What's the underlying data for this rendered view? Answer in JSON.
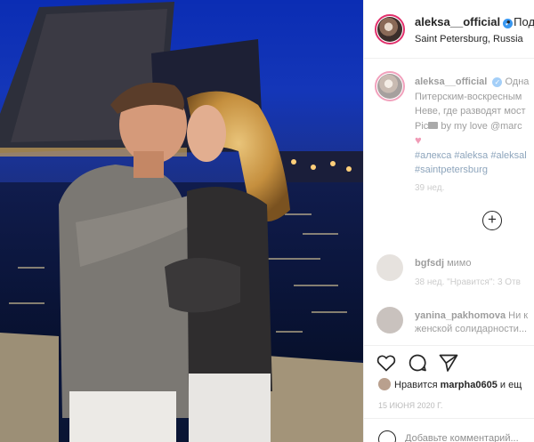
{
  "photo": {
    "description_icon": "photo-icon"
  },
  "header": {
    "username": "aleksa__official",
    "verified_icon": "verified-badge-icon",
    "follow_label": "• Под",
    "location": "Saint Petersburg, Russia"
  },
  "caption": {
    "username": "aleksa__official",
    "line1": "Одна",
    "line2": "Питерским-воскресным",
    "line3": "Неве, где разводят мост",
    "line4_prefix": "Pic",
    "line4_suffix": " by my love @marc",
    "heart": "♥",
    "hashtags_line1": "#алекса #aleksa #aleksal",
    "hashtags_line2": "#saintpetersburg",
    "time": "39 нед."
  },
  "load_more_icon": "plus-circle-icon",
  "comments": [
    {
      "user": "bgfsdj",
      "text": "мимо",
      "meta": "38 нед.    \"Нравится\": 3    Отв"
    },
    {
      "user": "yanina_pakhomova",
      "text": "Ни к",
      "line2": "женской солидарности..."
    }
  ],
  "actions": {
    "like_icon": "heart-icon",
    "comment_icon": "comment-icon",
    "share_icon": "send-icon"
  },
  "likes": {
    "prefix": "Нравится ",
    "user": "marpha0605",
    "suffix": " и ещ"
  },
  "post_date": "15 ИЮНЯ 2020 Г.",
  "add_comment_placeholder": "Добавьте комментарий..."
}
